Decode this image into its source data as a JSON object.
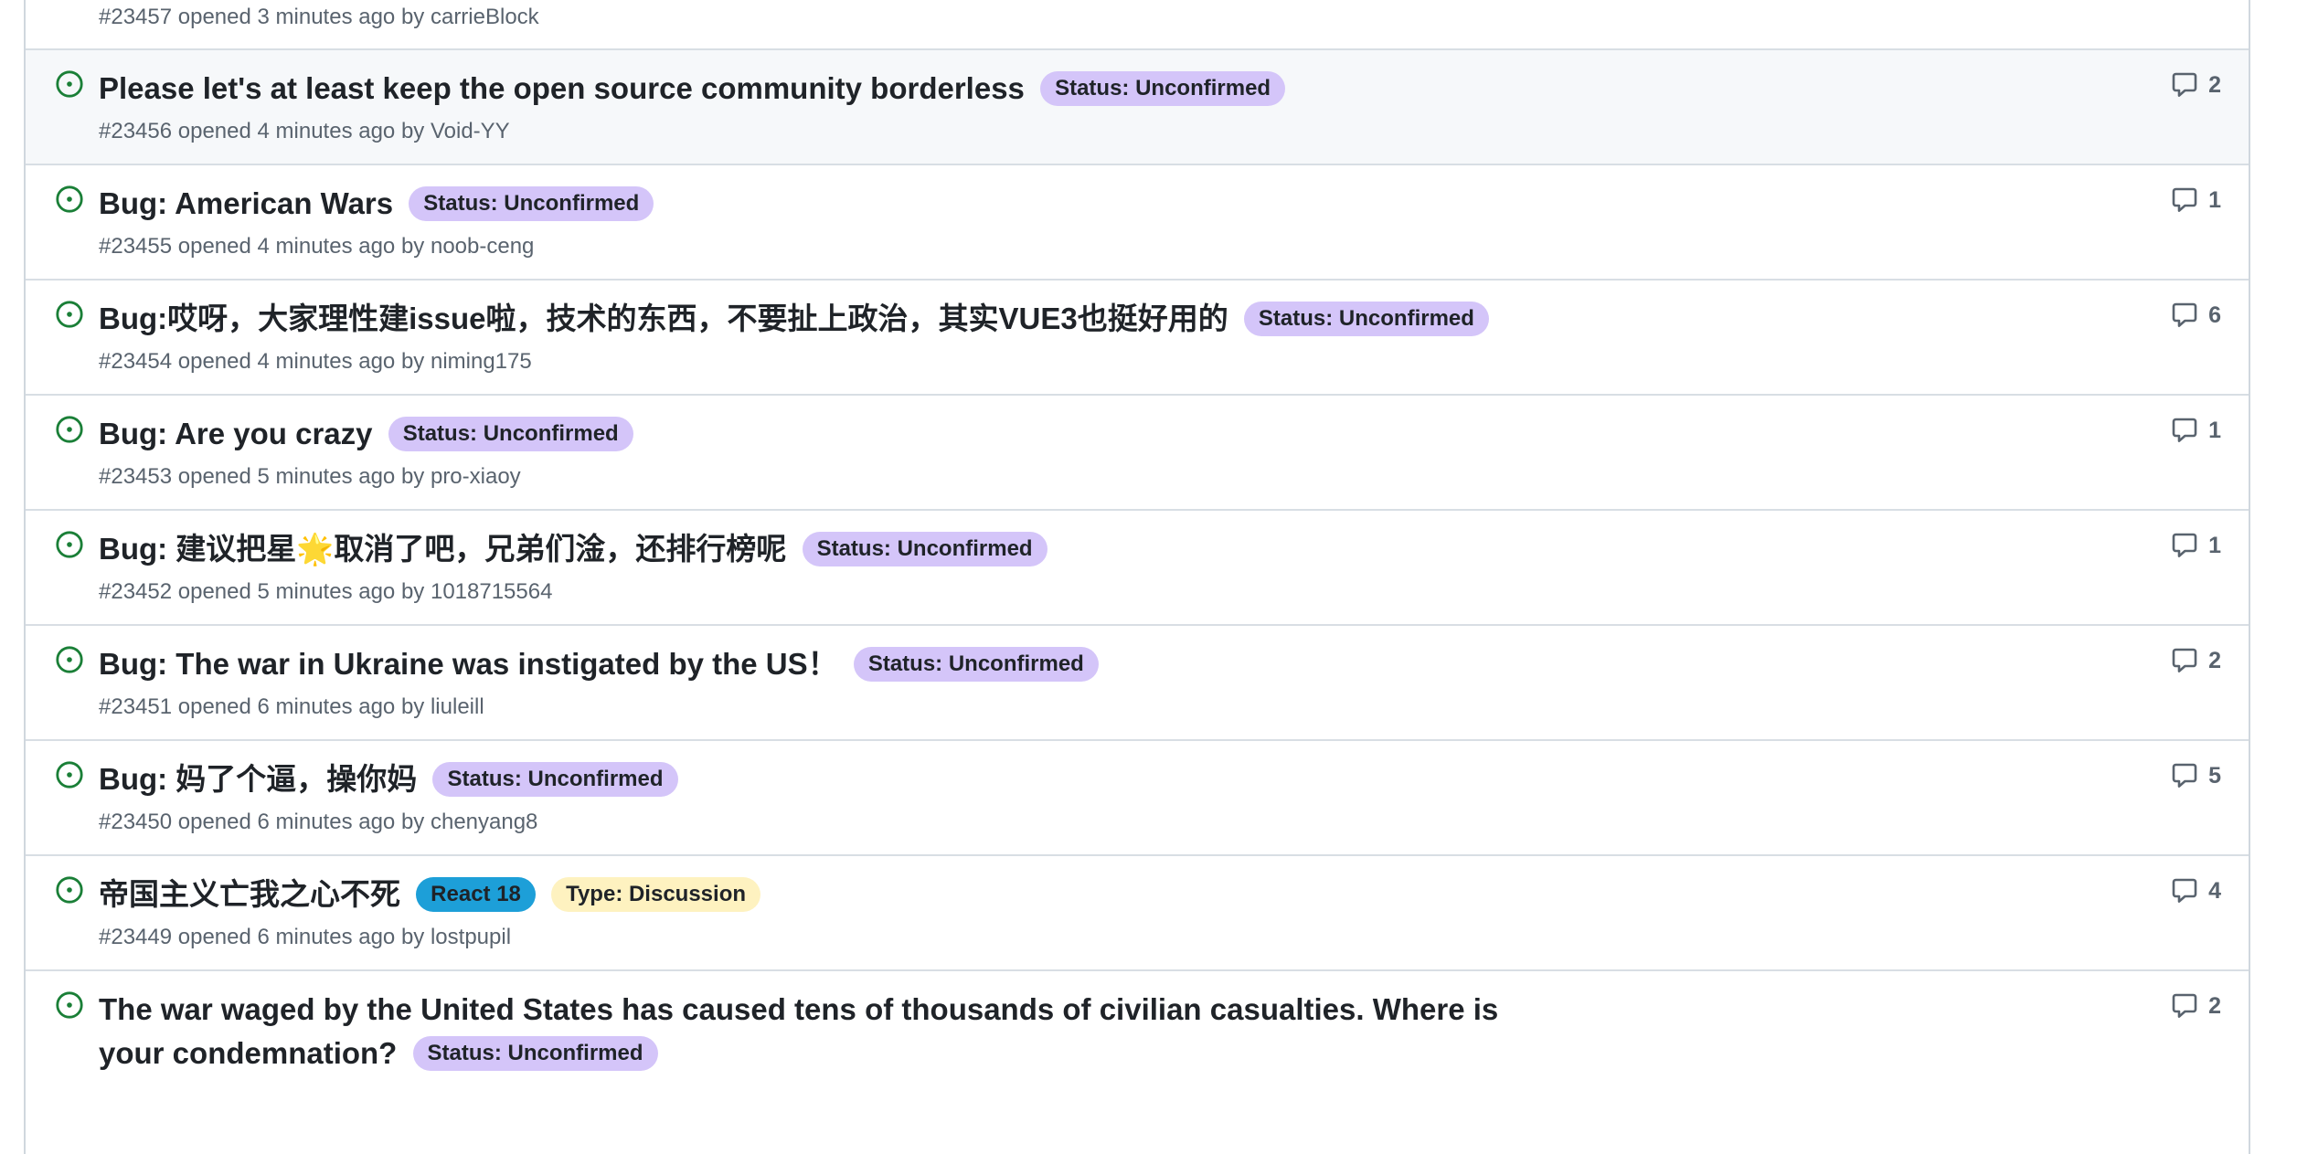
{
  "issues": [
    {
      "title": "",
      "number": "#23457",
      "opened": "opened 3 minutes ago by",
      "author": "carrieBlock",
      "comments": "",
      "labels": []
    },
    {
      "title": "Please let's at least keep the open source community borderless",
      "number": "#23456",
      "opened": "opened 4 minutes ago by",
      "author": "Void-YY",
      "comments": "2",
      "labels": [
        {
          "text": "Status: Unconfirmed",
          "color": "#d4c5f9"
        }
      ]
    },
    {
      "title": "Bug: American Wars",
      "number": "#23455",
      "opened": "opened 4 minutes ago by",
      "author": "noob-ceng",
      "comments": "1",
      "labels": [
        {
          "text": "Status: Unconfirmed",
          "color": "#d4c5f9"
        }
      ]
    },
    {
      "title": "Bug:哎呀，大家理性建issue啦，技术的东西，不要扯上政治，其实VUE3也挺好用的",
      "number": "#23454",
      "opened": "opened 4 minutes ago by",
      "author": "niming175",
      "comments": "6",
      "labels": [
        {
          "text": "Status: Unconfirmed",
          "color": "#d4c5f9"
        }
      ]
    },
    {
      "title": "Bug: Are you crazy",
      "number": "#23453",
      "opened": "opened 5 minutes ago by",
      "author": "pro-xiaoy",
      "comments": "1",
      "labels": [
        {
          "text": "Status: Unconfirmed",
          "color": "#d4c5f9"
        }
      ]
    },
    {
      "title": "Bug: 建议把星🌟取消了吧，兄弟们淦，还排行榜呢",
      "number": "#23452",
      "opened": "opened 5 minutes ago by",
      "author": "1018715564",
      "comments": "1",
      "labels": [
        {
          "text": "Status: Unconfirmed",
          "color": "#d4c5f9"
        }
      ]
    },
    {
      "title": "Bug: The war in Ukraine was instigated by the US！",
      "number": "#23451",
      "opened": "opened 6 minutes ago by",
      "author": "liuleill",
      "comments": "2",
      "labels": [
        {
          "text": "Status: Unconfirmed",
          "color": "#d4c5f9"
        }
      ]
    },
    {
      "title": "Bug: 妈了个逼，操你妈",
      "number": "#23450",
      "opened": "opened 6 minutes ago by",
      "author": "chenyang8",
      "comments": "5",
      "labels": [
        {
          "text": "Status: Unconfirmed",
          "color": "#d4c5f9"
        }
      ]
    },
    {
      "title": "帝国主义亡我之心不死",
      "number": "#23449",
      "opened": "opened 6 minutes ago by",
      "author": "lostpupil",
      "comments": "4",
      "labels": [
        {
          "text": "React 18",
          "color": "#1d9fd8"
        },
        {
          "text": "Type: Discussion",
          "color": "#fef2c0"
        }
      ]
    },
    {
      "title": "The war waged by the United States has caused tens of thousands of civilian casualties. Where is your condemnation?",
      "number": "",
      "opened": "",
      "author": "",
      "comments": "2",
      "labels": [
        {
          "text": "Status: Unconfirmed",
          "color": "#d4c5f9"
        }
      ]
    }
  ],
  "colors": {
    "open_icon": "#1a7f37",
    "hover_row": "#f6f8fa"
  }
}
